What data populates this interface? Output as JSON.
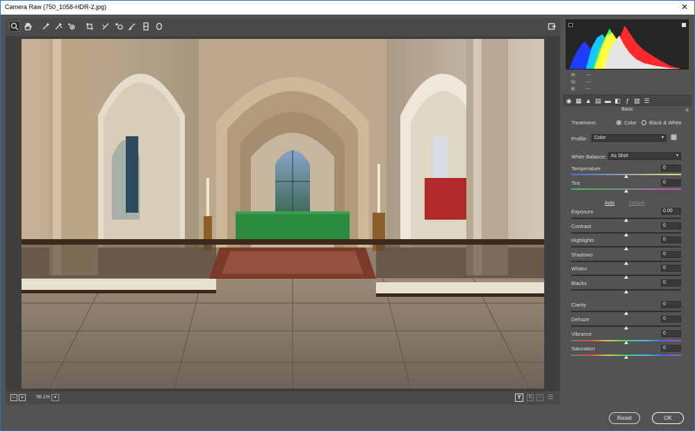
{
  "window": {
    "title": "Camera Raw (750_1058-HDR-2.jpg)",
    "close_glyph": "✕"
  },
  "toolbar": {
    "tools": [
      "zoom-tool",
      "hand-tool",
      "white-balance-tool",
      "color-sampler-tool",
      "targeted-adjustment-tool",
      "crop-tool",
      "straighten-tool",
      "spot-removal-tool",
      "red-eye-tool",
      "adjustment-brush-tool",
      "graduated-filter-tool",
      "radial-filter-tool"
    ],
    "active_tool": "zoom-tool"
  },
  "status": {
    "zoom_minus": "−",
    "zoom_plus": "+",
    "zoom_level": "56.1%",
    "zoom_dropdown": "▾",
    "before_after": "Y"
  },
  "readout": {
    "r_label": "R:",
    "g_label": "G:",
    "b_label": "B:",
    "r_value": "---",
    "g_value": "---",
    "b_value": "---"
  },
  "panel": {
    "title": "Basic",
    "menu_glyph": "≡",
    "treatment_label": "Treatment:",
    "treatment_color": "Color",
    "treatment_bw": "Black & White",
    "treatment_selected": "Color",
    "profile_label": "Profile:",
    "profile_value": "Color",
    "white_balance_label": "White Balance:",
    "white_balance_value": "As Shot",
    "auto_label": "Auto",
    "default_label": "Default",
    "temperature": {
      "label": "Temperature",
      "value": "0"
    },
    "tint": {
      "label": "Tint",
      "value": "0"
    },
    "exposure": {
      "label": "Exposure",
      "value": "0.00"
    },
    "contrast": {
      "label": "Contrast",
      "value": "0"
    },
    "highlights": {
      "label": "Highlights",
      "value": "0"
    },
    "shadows": {
      "label": "Shadows",
      "value": "0"
    },
    "whites": {
      "label": "Whites",
      "value": "0"
    },
    "blacks": {
      "label": "Blacks",
      "value": "0"
    },
    "clarity": {
      "label": "Clarity",
      "value": "0"
    },
    "dehaze": {
      "label": "Dehaze",
      "value": "0"
    },
    "vibrance": {
      "label": "Vibrance",
      "value": "0"
    },
    "saturation": {
      "label": "Saturation",
      "value": "0"
    }
  },
  "buttons": {
    "reset": "Reset",
    "ok": "OK"
  },
  "colors": {
    "background": "#535353",
    "canvas": "#3e3e3e",
    "accent": "#ffffff",
    "altar_cloth": "#2a8a3d",
    "stone": "#b9a58a"
  }
}
